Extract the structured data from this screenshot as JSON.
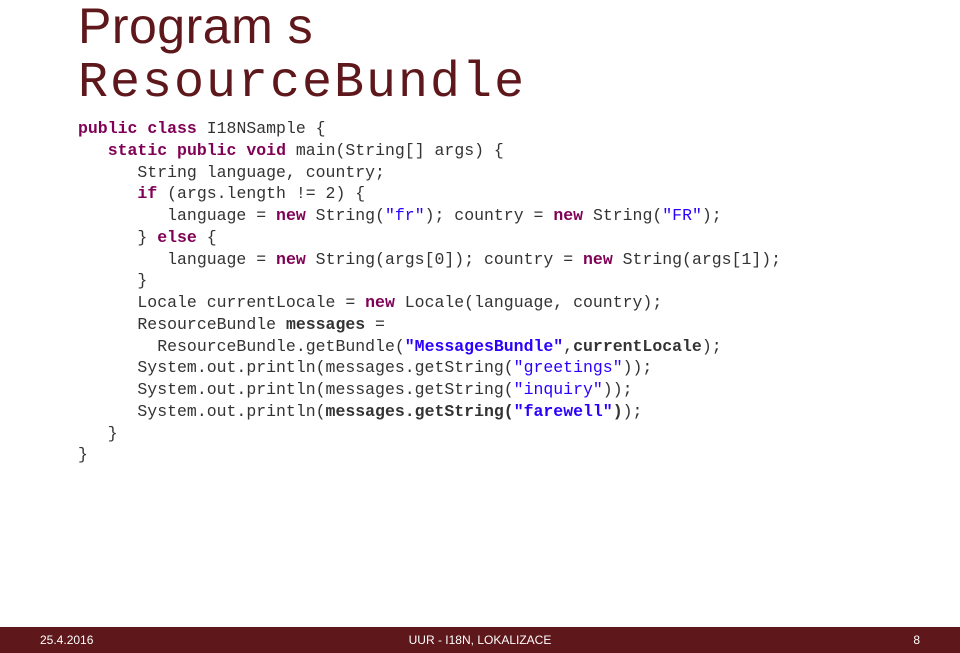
{
  "title": {
    "line1": "Program s",
    "line2": "ResourceBundle"
  },
  "code": {
    "t0": "public",
    "t1": "class",
    "t2": "I18NSample",
    "t3": "static",
    "t4": "public",
    "t5": "void",
    "t6": "main",
    "t7": "if",
    "t8": "new",
    "t9": "else",
    "t10": "messages",
    "t11": "currentLocale",
    "t12": "messages.getString(",
    "t13": ")",
    "s0": "\"fr\"",
    "s1": "\"FR\"",
    "s2": "\"MessagesBundle\"",
    "s3": "\"greetings\"",
    "s4": "\"inquiry\"",
    "s5": "\"farewell\""
  },
  "footer": {
    "date": "25.4.2016",
    "title": "UUR - I18N, LOKALIZACE",
    "page": "8"
  }
}
